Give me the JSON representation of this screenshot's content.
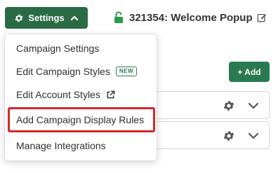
{
  "header": {
    "settings_label": "Settings",
    "campaign_title": "321354: Welcome Popup"
  },
  "page": {
    "add_label": "+ Add"
  },
  "dropdown": {
    "items": [
      {
        "label": "Campaign Settings"
      },
      {
        "label": "Edit Campaign Styles",
        "badge": "NEW"
      },
      {
        "label": "Edit Account Styles"
      },
      {
        "label": "Add Campaign Display Rules"
      },
      {
        "label": "Manage Integrations"
      }
    ]
  },
  "colors": {
    "primary_green": "#2a6b45",
    "highlight_red": "#d6262b",
    "lock_green": "#2a9a4a"
  },
  "icons": {
    "settings": "gear-icon",
    "settings_toggle": "chevron-up-icon",
    "status": "lock-open-icon",
    "edit": "pencil-icon",
    "external": "external-link-icon",
    "row_settings": "gear-icon",
    "row_expand": "chevron-down-icon"
  }
}
